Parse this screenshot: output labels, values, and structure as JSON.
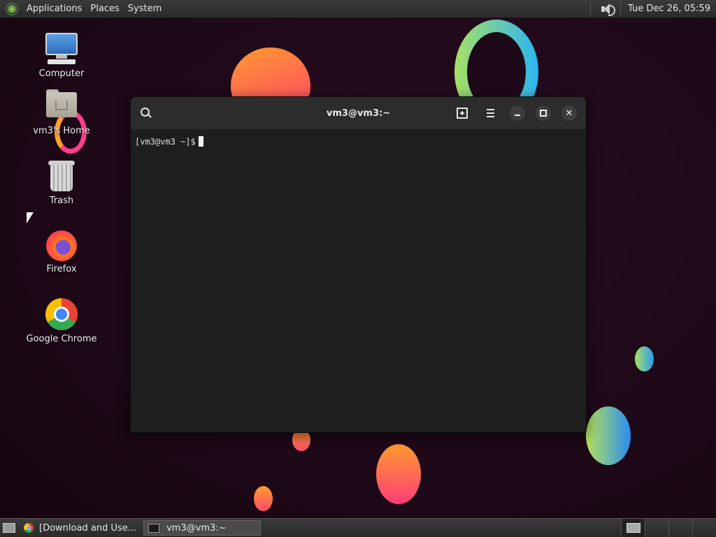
{
  "top_panel": {
    "menu": [
      "Applications",
      "Places",
      "System"
    ],
    "clock": "Tue Dec 26, 05:59",
    "icons": [
      "menu-logo-icon",
      "volume-icon"
    ]
  },
  "desktop": {
    "icons": [
      {
        "label": "Computer",
        "icon": "computer-icon"
      },
      {
        "label": "vm3's Home",
        "icon": "home-folder-icon"
      },
      {
        "label": "Trash",
        "icon": "trash-icon"
      },
      {
        "label": "Firefox",
        "icon": "firefox-icon"
      },
      {
        "label": "Google Chrome",
        "icon": "chrome-icon"
      }
    ]
  },
  "terminal": {
    "title": "vm3@vm3:~",
    "prompt": "[vm3@vm3 ~]$"
  },
  "taskbar": {
    "tasks": [
      {
        "label": "[Download and Use..."
      },
      {
        "label": "vm3@vm3:~"
      }
    ]
  },
  "colors": {
    "background": "#1e0918",
    "panel": "#2b2b2b",
    "terminal_bg": "#1e1e1e",
    "titlebar": "#2c2c2c"
  }
}
